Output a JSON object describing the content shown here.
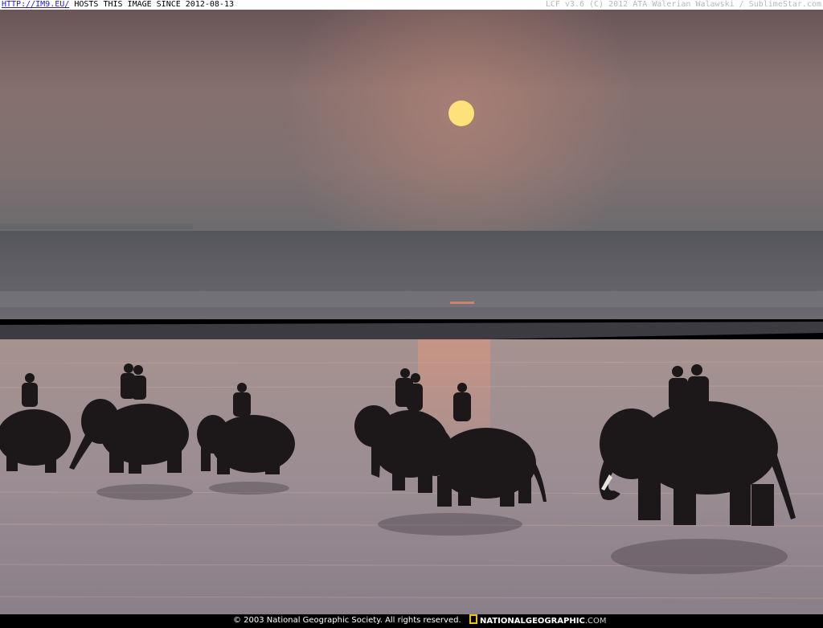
{
  "topbar": {
    "link_text": "HTTP://IM9.EU/",
    "host_text": " HOSTS THIS IMAGE SINCE 2012-08-13",
    "right_text": "LCF v3.6 (C) 2012 ATA Walerian Walawski / SublimeStar.com"
  },
  "footer": {
    "copyright": "© 2003 National Geographic Society. All rights reserved.",
    "brand_main": "NATIONALGEOGRAPHIC",
    "brand_tld": ".COM"
  },
  "colors": {
    "sky_top": "#6a5656",
    "sky_mid": "#8c7673",
    "horizon": "#6c6a6d",
    "sun": "#fde27a",
    "water": "#9c8a8e",
    "silhouette": "#1a1618",
    "frame_bar": "#000000"
  },
  "icons": {
    "brand_logo": "yellow-border-rectangle-icon"
  }
}
